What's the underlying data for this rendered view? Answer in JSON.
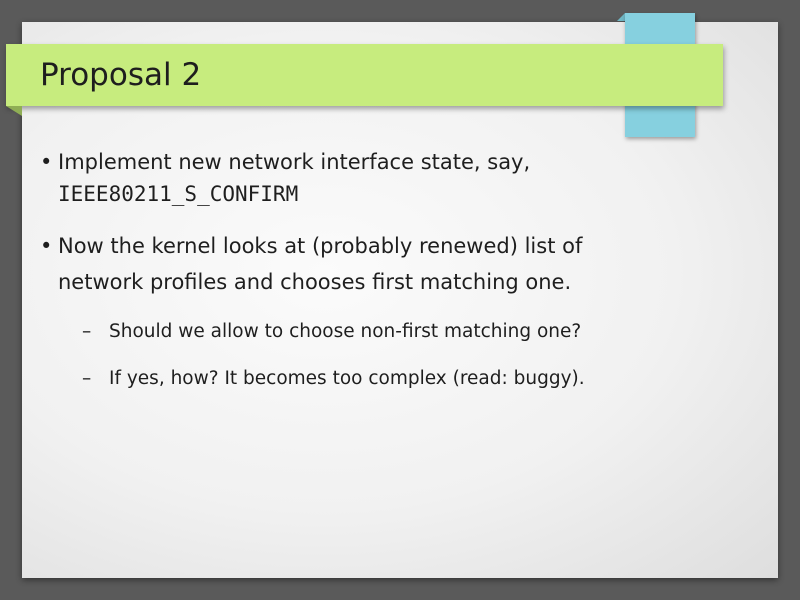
{
  "slide": {
    "title": "Proposal 2",
    "bullets": [
      {
        "marker": "•",
        "line1": "Implement new network interface state, say,",
        "line2": "IEEE80211_S_CONFIRM"
      },
      {
        "marker": "•",
        "line1": "Now the kernel looks at (probably renewed) list of",
        "line2": "network profiles and chooses first matching one."
      }
    ],
    "sub_bullets": [
      {
        "marker": "–",
        "text": "Should we allow to choose non-first matching one?"
      },
      {
        "marker": "–",
        "text": "If yes, how? It becomes too complex (read: buggy)."
      }
    ]
  },
  "colors": {
    "background": "#5a5a5a",
    "title_bar": "#c7ec7e",
    "accent_block": "#86d0df",
    "text": "#1e1e1e"
  }
}
